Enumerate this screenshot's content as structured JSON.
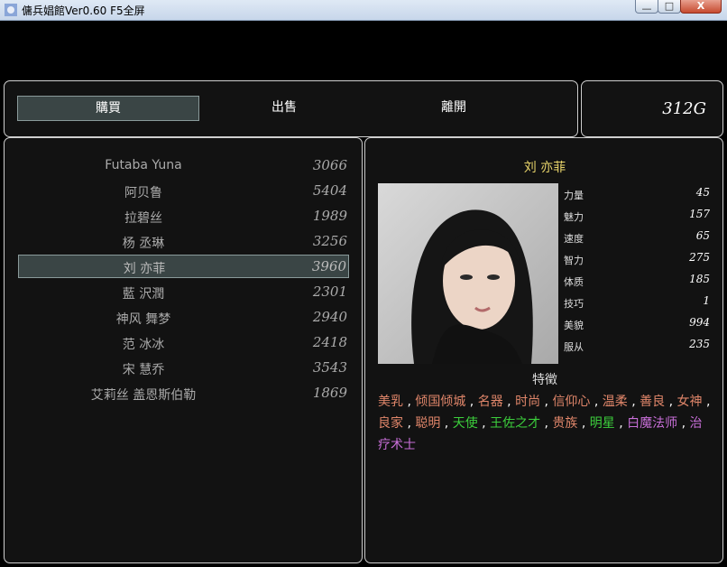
{
  "window": {
    "title": "傭兵娼館Ver0.60 F5全屏",
    "min_glyph": "—",
    "max_glyph": "□",
    "close_glyph": "X"
  },
  "menu": {
    "buy": "購買",
    "sell": "出售",
    "leave": "離開"
  },
  "gold": "312G",
  "list": [
    {
      "name": "Futaba Yuna",
      "price": "3066"
    },
    {
      "name": "阿贝鲁",
      "price": "5404"
    },
    {
      "name": "拉碧丝",
      "price": "1989"
    },
    {
      "name": "杨 丞琳",
      "price": "3256"
    },
    {
      "name": "刘 亦菲",
      "price": "3960"
    },
    {
      "name": "藍 沢潤",
      "price": "2301"
    },
    {
      "name": "神风 舞梦",
      "price": "2940"
    },
    {
      "name": "范 冰冰",
      "price": "2418"
    },
    {
      "name": "宋 慧乔",
      "price": "3543"
    },
    {
      "name": "艾莉丝  盖恩斯伯勒",
      "price": "1869"
    }
  ],
  "selected_index": 4,
  "detail": {
    "name": "刘 亦菲",
    "stats": [
      {
        "label": "力量",
        "value": "45"
      },
      {
        "label": "魅力",
        "value": "157"
      },
      {
        "label": "速度",
        "value": "65"
      },
      {
        "label": "智力",
        "value": "275"
      },
      {
        "label": "体质",
        "value": "185"
      },
      {
        "label": "技巧",
        "value": "1"
      },
      {
        "label": "美貌",
        "value": "994"
      },
      {
        "label": "服从",
        "value": "235"
      }
    ],
    "traits_title": "特徵",
    "traits": [
      {
        "text": "美乳",
        "color": "#e0866a"
      },
      {
        "text": "倾国倾城",
        "color": "#e0866a"
      },
      {
        "text": "名器",
        "color": "#e0866a"
      },
      {
        "text": "时尚",
        "color": "#e0866a"
      },
      {
        "text": "信仰心",
        "color": "#e0866a"
      },
      {
        "text": "温柔",
        "color": "#e0866a"
      },
      {
        "text": "善良",
        "color": "#e0866a"
      },
      {
        "text": "女神",
        "color": "#e0866a"
      },
      {
        "text": "良家",
        "color": "#e0866a"
      },
      {
        "text": "聪明",
        "color": "#e0866a"
      },
      {
        "text": "天使",
        "color": "#3ccf3c"
      },
      {
        "text": "王佐之才",
        "color": "#3ccf3c"
      },
      {
        "text": "贵族",
        "color": "#e0866a"
      },
      {
        "text": "明星",
        "color": "#3ccf3c"
      },
      {
        "text": "白魔法师",
        "color": "#c86fd8"
      },
      {
        "text": "治疗术士",
        "color": "#c86fd8"
      }
    ]
  }
}
